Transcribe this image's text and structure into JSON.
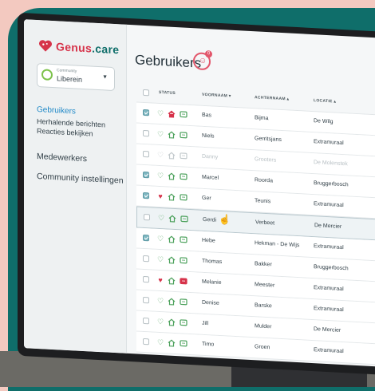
{
  "brand": {
    "name_part1": "Genus",
    "name_part2": ".care"
  },
  "community": {
    "label": "Community",
    "value": "Liberein"
  },
  "nav": {
    "users": "Gebruikers",
    "recurring": "Herhalende berichten",
    "reactions": "Reacties bekijken",
    "staff": "Medewerkers",
    "settings": "Community instellingen"
  },
  "page": {
    "title": "Gebruikers",
    "badge_count": "0"
  },
  "table": {
    "headers": {
      "status": "STATUS",
      "first": "VOORNAAM ▾",
      "last": "ACHTERNAAM ▴",
      "location": "LOCATIE ▴"
    },
    "rows": [
      {
        "checked": true,
        "heart": "green",
        "home": "red",
        "chat": "green",
        "first": "Bas",
        "last": "Bijma",
        "location": "De Wilg"
      },
      {
        "checked": false,
        "heart": "green",
        "home": "green",
        "chat": "green",
        "first": "Niels",
        "last": "Gerritsjans",
        "location": "Extramuraal"
      },
      {
        "checked": false,
        "heart": "grey",
        "home": "grey",
        "chat": "grey",
        "first": "Danny",
        "last": "Grooters",
        "location": "De Molenstek",
        "muted": true
      },
      {
        "checked": true,
        "heart": "green",
        "home": "green",
        "chat": "green",
        "first": "Marcel",
        "last": "Roorda",
        "location": "Bruggerbosch"
      },
      {
        "checked": true,
        "heart": "red",
        "home": "green",
        "chat": "green",
        "first": "Ger",
        "last": "Teunis",
        "location": "Extramuraal"
      },
      {
        "checked": false,
        "heart": "green",
        "home": "green",
        "chat": "green",
        "first": "Gerdi",
        "last": "Verbeet",
        "location": "De Mercier",
        "selected": true
      },
      {
        "checked": true,
        "heart": "green",
        "home": "green",
        "chat": "green",
        "first": "Hebe",
        "last": "Hekman - De Wijs",
        "location": "Extramuraal"
      },
      {
        "checked": false,
        "heart": "green",
        "home": "green",
        "chat": "green",
        "first": "Thomas",
        "last": "Bakker",
        "location": "Bruggerbosch"
      },
      {
        "checked": false,
        "heart": "red",
        "home": "green",
        "chat": "red",
        "first": "Melanie",
        "last": "Meester",
        "location": "Extramuraal"
      },
      {
        "checked": false,
        "heart": "green",
        "home": "green",
        "chat": "green",
        "first": "Denise",
        "last": "Barske",
        "location": "Extramuraal"
      },
      {
        "checked": false,
        "heart": "green",
        "home": "green",
        "chat": "green",
        "first": "Jill",
        "last": "Mulder",
        "location": "De Mercier"
      },
      {
        "checked": false,
        "heart": "green",
        "home": "green",
        "chat": "green",
        "first": "Timo",
        "last": "Groen",
        "location": "Extramuraal"
      }
    ]
  },
  "colors": {
    "green": "#4aa05a",
    "red": "#d6334a",
    "grey": "#c3cacd",
    "teal": "#0f6e6a",
    "link": "#1e88c7"
  }
}
